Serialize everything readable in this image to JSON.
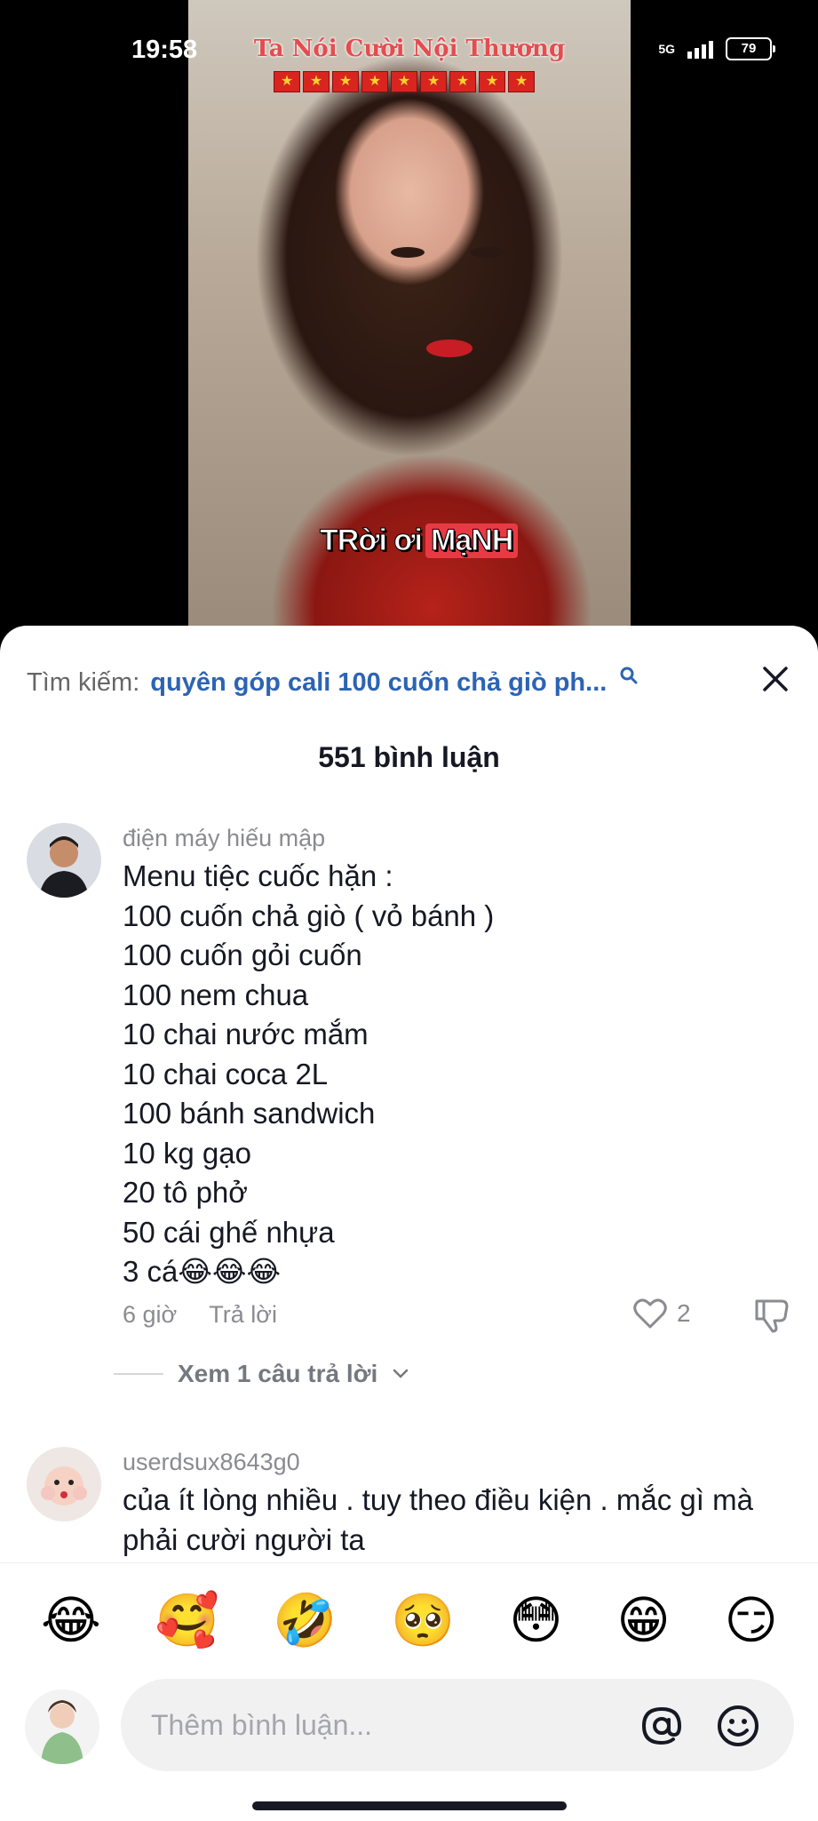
{
  "status_bar": {
    "time": "19:58",
    "network": "5G",
    "battery": "79"
  },
  "video": {
    "overlay_title": "Ta Nói Cười Nội Thương",
    "flag_star": "★",
    "subtitle_part1": "TRời ơi",
    "subtitle_part2": "MạNH"
  },
  "sheet": {
    "search_prefix": "Tìm kiếm:",
    "search_query": "quyên góp cali 100 cuốn chả giò ph...",
    "title": "551 bình luận"
  },
  "comments": [
    {
      "username": "điện máy hiếu mập",
      "text": "Menu tiệc cuốc hặn :\n100 cuốn chả giò ( vỏ bánh )\n100 cuốn gỏi cuốn\n100 nem chua\n10 chai nước mắm\n10 chai coca 2L\n100 bánh sandwich\n10 kg gạo\n20 tô phở\n50 cái ghế nhựa\n3 cá😂😂😂",
      "time": "6 giờ",
      "reply_label": "Trả lời",
      "likes": "2",
      "view_replies": "Xem 1 câu trả lời"
    },
    {
      "username": "userdsux8643g0",
      "text": "của ít lòng nhiều . tuy theo điều kiện . mắc gì mà phải cười người ta"
    }
  ],
  "emoji_bar": [
    "😂",
    "🥰",
    "🤣",
    "🥺",
    "😳",
    "😁",
    "😏"
  ],
  "composer": {
    "placeholder": "Thêm bình luận..."
  }
}
